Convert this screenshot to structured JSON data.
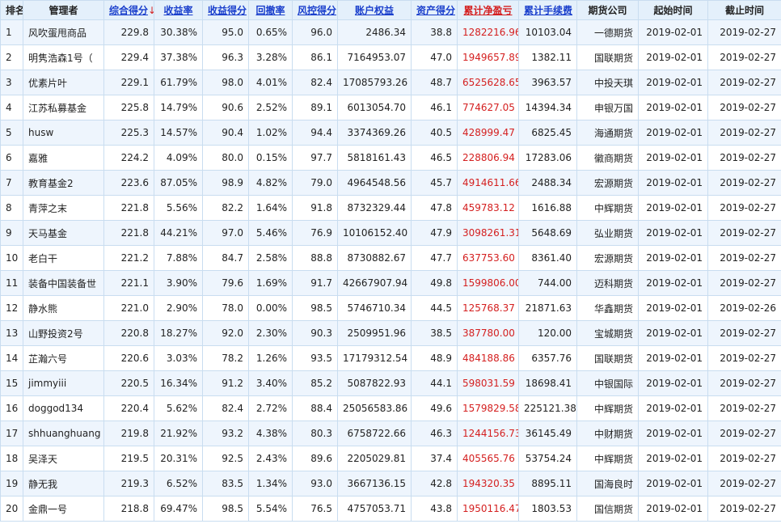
{
  "headers": {
    "rank": "排名",
    "manager": "管理者",
    "composite": "综合得分",
    "composite_arrow": "↓",
    "return_rate": "收益率",
    "return_score": "收益得分",
    "drawdown": "回撤率",
    "risk_score": "风控得分",
    "equity": "账户权益",
    "asset_score": "资产得分",
    "net_pnl": "累计净盈亏",
    "fees": "累计手续费",
    "company": "期货公司",
    "start": "起始时间",
    "end": "截止时间"
  },
  "colors": {
    "header_bg": "#e4f0fb",
    "row_alt": "#eef5fd",
    "link": "#1a3fcc",
    "profit": "#d41f1f"
  },
  "rows": [
    [
      "1",
      "风吹蛋甩商品",
      "229.8",
      "30.38%",
      "95.0",
      "0.65%",
      "96.0",
      "2486.34",
      "38.8",
      "1282216.96",
      "10103.04",
      "一德期货",
      "2019-02-01",
      "2019-02-27"
    ],
    [
      "2",
      "明隽浩森1号（",
      "229.4",
      "37.38%",
      "96.3",
      "3.28%",
      "86.1",
      "7164953.07",
      "47.0",
      "1949657.89",
      "1382.11",
      "国联期货",
      "2019-02-01",
      "2019-02-27"
    ],
    [
      "3",
      "优素片叶",
      "229.1",
      "61.79%",
      "98.0",
      "4.01%",
      "82.4",
      "17085793.26",
      "48.7",
      "6525628.65",
      "3963.57",
      "中投天琪",
      "2019-02-01",
      "2019-02-27"
    ],
    [
      "4",
      "江苏私募基金",
      "225.8",
      "14.79%",
      "90.6",
      "2.52%",
      "89.1",
      "6013054.70",
      "46.1",
      "774627.05",
      "14394.34",
      "申银万国",
      "2019-02-01",
      "2019-02-27"
    ],
    [
      "5",
      "husw",
      "225.3",
      "14.57%",
      "90.4",
      "1.02%",
      "94.4",
      "3374369.26",
      "40.5",
      "428999.47",
      "6825.45",
      "海通期货",
      "2019-02-01",
      "2019-02-27"
    ],
    [
      "6",
      "嘉雅",
      "224.2",
      "4.09%",
      "80.0",
      "0.15%",
      "97.7",
      "5818161.43",
      "46.5",
      "228806.94",
      "17283.06",
      "徽商期货",
      "2019-02-01",
      "2019-02-27"
    ],
    [
      "7",
      "教育基金2",
      "223.6",
      "87.05%",
      "98.9",
      "4.82%",
      "79.0",
      "4964548.56",
      "45.7",
      "4914611.66",
      "2488.34",
      "宏源期货",
      "2019-02-01",
      "2019-02-27"
    ],
    [
      "8",
      "青萍之末",
      "221.8",
      "5.56%",
      "82.2",
      "1.64%",
      "91.8",
      "8732329.44",
      "47.8",
      "459783.12",
      "1616.88",
      "中辉期货",
      "2019-02-01",
      "2019-02-27"
    ],
    [
      "9",
      "天马基金",
      "221.8",
      "44.21%",
      "97.0",
      "5.46%",
      "76.9",
      "10106152.40",
      "47.9",
      "3098261.31",
      "5648.69",
      "弘业期货",
      "2019-02-01",
      "2019-02-27"
    ],
    [
      "10",
      "老白干",
      "221.2",
      "7.88%",
      "84.7",
      "2.58%",
      "88.8",
      "8730882.67",
      "47.7",
      "637753.60",
      "8361.40",
      "宏源期货",
      "2019-02-01",
      "2019-02-27"
    ],
    [
      "11",
      "装备中国装备世",
      "221.1",
      "3.90%",
      "79.6",
      "1.69%",
      "91.7",
      "42667907.94",
      "49.8",
      "1599806.00",
      "744.00",
      "迈科期货",
      "2019-02-01",
      "2019-02-27"
    ],
    [
      "12",
      "静水熊",
      "221.0",
      "2.90%",
      "78.0",
      "0.00%",
      "98.5",
      "5746710.34",
      "44.5",
      "125768.37",
      "21871.63",
      "华鑫期货",
      "2019-02-01",
      "2019-02-26"
    ],
    [
      "13",
      "山野投资2号",
      "220.8",
      "18.27%",
      "92.0",
      "2.30%",
      "90.3",
      "2509951.96",
      "38.5",
      "387780.00",
      "120.00",
      "宝城期货",
      "2019-02-01",
      "2019-02-27"
    ],
    [
      "14",
      "芷瀚六号",
      "220.6",
      "3.03%",
      "78.2",
      "1.26%",
      "93.5",
      "17179312.54",
      "48.9",
      "484188.86",
      "6357.76",
      "国联期货",
      "2019-02-01",
      "2019-02-27"
    ],
    [
      "15",
      "jimmyiii",
      "220.5",
      "16.34%",
      "91.2",
      "3.40%",
      "85.2",
      "5087822.93",
      "44.1",
      "598031.59",
      "18698.41",
      "中银国际",
      "2019-02-01",
      "2019-02-27"
    ],
    [
      "16",
      "doggod134",
      "220.4",
      "5.62%",
      "82.4",
      "2.72%",
      "88.4",
      "25056583.86",
      "49.6",
      "1579829.58",
      "225121.38",
      "中辉期货",
      "2019-02-01",
      "2019-02-27"
    ],
    [
      "17",
      "shhuanghuang",
      "219.8",
      "21.92%",
      "93.2",
      "4.38%",
      "80.3",
      "6758722.66",
      "46.3",
      "1244156.73",
      "36145.49",
      "中财期货",
      "2019-02-01",
      "2019-02-27"
    ],
    [
      "18",
      "吴泽天",
      "219.5",
      "20.31%",
      "92.5",
      "2.43%",
      "89.6",
      "2205029.81",
      "37.4",
      "405565.76",
      "53754.24",
      "中辉期货",
      "2019-02-01",
      "2019-02-27"
    ],
    [
      "19",
      "静无我",
      "219.3",
      "6.52%",
      "83.5",
      "1.34%",
      "93.0",
      "3667136.15",
      "42.8",
      "194320.35",
      "8895.11",
      "国海良时",
      "2019-02-01",
      "2019-02-27"
    ],
    [
      "20",
      "金鼎一号",
      "218.8",
      "69.47%",
      "98.5",
      "5.54%",
      "76.5",
      "4757053.71",
      "43.8",
      "1950116.47",
      "1803.53",
      "国信期货",
      "2019-02-01",
      "2019-02-27"
    ]
  ]
}
